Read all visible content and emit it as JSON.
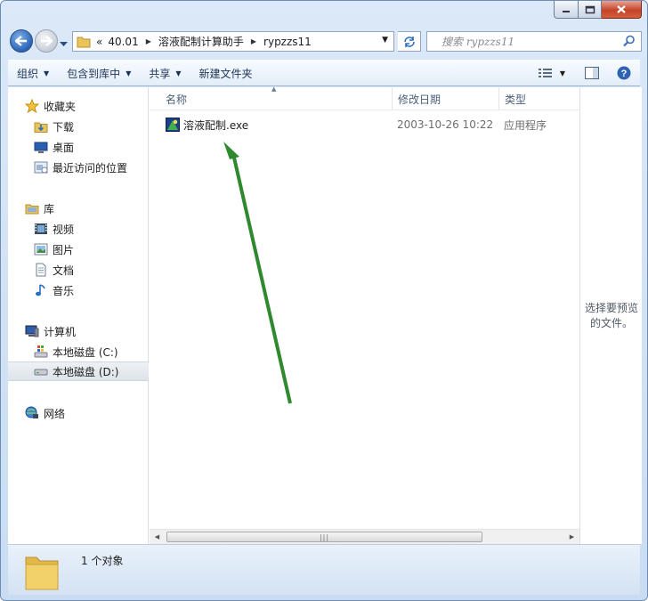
{
  "window": {
    "caption_buttons": [
      "minimize-icon",
      "maximize-icon",
      "close-icon"
    ]
  },
  "address_bar": {
    "overflow": "«",
    "segments": [
      "40.01",
      "溶液配制计算助手",
      "rypzzs11"
    ]
  },
  "search": {
    "placeholder": "搜索 rypzzs11"
  },
  "toolbar": {
    "organize": "组织",
    "include_in_library": "包含到库中",
    "share": "共享",
    "new_folder": "新建文件夹"
  },
  "nav": {
    "favorites": {
      "label": "收藏夹",
      "items": [
        {
          "label": "下载",
          "icon": "download-folder-icon"
        },
        {
          "label": "桌面",
          "icon": "desktop-icon"
        },
        {
          "label": "最近访问的位置",
          "icon": "recent-places-icon"
        }
      ]
    },
    "libraries": {
      "label": "库",
      "items": [
        {
          "label": "视频",
          "icon": "video-library-icon"
        },
        {
          "label": "图片",
          "icon": "picture-library-icon"
        },
        {
          "label": "文档",
          "icon": "document-library-icon"
        },
        {
          "label": "音乐",
          "icon": "music-library-icon"
        }
      ]
    },
    "computer": {
      "label": "计算机",
      "items": [
        {
          "label": "本地磁盘 (C:)",
          "icon": "system-drive-icon"
        },
        {
          "label": "本地磁盘 (D:)",
          "icon": "drive-icon",
          "selected": true
        }
      ]
    },
    "network": {
      "label": "网络"
    }
  },
  "columns": {
    "name": "名称",
    "modified": "修改日期",
    "type": "类型"
  },
  "files": [
    {
      "name": "溶液配制.exe",
      "modified": "2003-10-26 10:22",
      "type": "应用程序",
      "icon": "exe-app-icon"
    }
  ],
  "preview": {
    "line1": "选择要预览",
    "line2": "的文件。"
  },
  "status": {
    "count": "1 个对象"
  },
  "colors": {
    "annotation_arrow": "#2f8a2f",
    "window_frame": "#c9dcf2",
    "close_button": "#c4442a"
  }
}
